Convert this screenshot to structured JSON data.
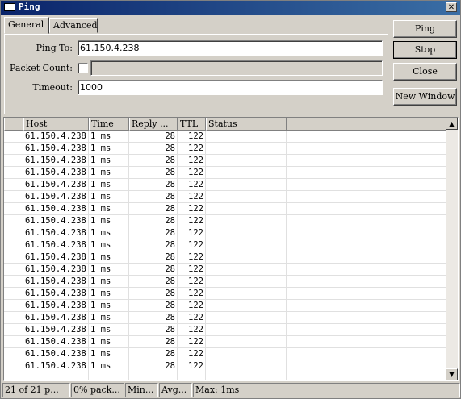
{
  "window": {
    "title": "Ping",
    "close_label": "✕"
  },
  "tabs": [
    {
      "label": "General"
    },
    {
      "label": "Advanced"
    }
  ],
  "form": {
    "ping_to_label": "Ping To:",
    "ping_to_value": "61.150.4.238",
    "packet_count_label": "Packet Count:",
    "packet_count_checked": false,
    "packet_count_value": "",
    "timeout_label": "Timeout:",
    "timeout_value": "1000"
  },
  "buttons": {
    "ping": "Ping",
    "stop": "Stop",
    "close": "Close",
    "new_window": "New Window"
  },
  "table": {
    "columns": [
      "Host",
      "Time",
      "Reply ...",
      "TTL",
      "Status"
    ],
    "rows": [
      [
        "61.150.4.238",
        "1 ms",
        "28",
        "122",
        ""
      ],
      [
        "61.150.4.238",
        "1 ms",
        "28",
        "122",
        ""
      ],
      [
        "61.150.4.238",
        "1 ms",
        "28",
        "122",
        ""
      ],
      [
        "61.150.4.238",
        "1 ms",
        "28",
        "122",
        ""
      ],
      [
        "61.150.4.238",
        "1 ms",
        "28",
        "122",
        ""
      ],
      [
        "61.150.4.238",
        "1 ms",
        "28",
        "122",
        ""
      ],
      [
        "61.150.4.238",
        "1 ms",
        "28",
        "122",
        ""
      ],
      [
        "61.150.4.238",
        "1 ms",
        "28",
        "122",
        ""
      ],
      [
        "61.150.4.238",
        "1 ms",
        "28",
        "122",
        ""
      ],
      [
        "61.150.4.238",
        "1 ms",
        "28",
        "122",
        ""
      ],
      [
        "61.150.4.238",
        "1 ms",
        "28",
        "122",
        ""
      ],
      [
        "61.150.4.238",
        "1 ms",
        "28",
        "122",
        ""
      ],
      [
        "61.150.4.238",
        "1 ms",
        "28",
        "122",
        ""
      ],
      [
        "61.150.4.238",
        "1 ms",
        "28",
        "122",
        ""
      ],
      [
        "61.150.4.238",
        "1 ms",
        "28",
        "122",
        ""
      ],
      [
        "61.150.4.238",
        "1 ms",
        "28",
        "122",
        ""
      ],
      [
        "61.150.4.238",
        "1 ms",
        "28",
        "122",
        ""
      ],
      [
        "61.150.4.238",
        "1 ms",
        "28",
        "122",
        ""
      ],
      [
        "61.150.4.238",
        "1 ms",
        "28",
        "122",
        ""
      ],
      [
        "61.150.4.238",
        "1 ms",
        "28",
        "122",
        ""
      ]
    ]
  },
  "statusbar": [
    "21 of 21 p...",
    "0% pack...",
    "Min...",
    "Avg...",
    "Max: 1ms"
  ],
  "icons": {
    "scroll_up": "▲",
    "scroll_down": "▼"
  }
}
